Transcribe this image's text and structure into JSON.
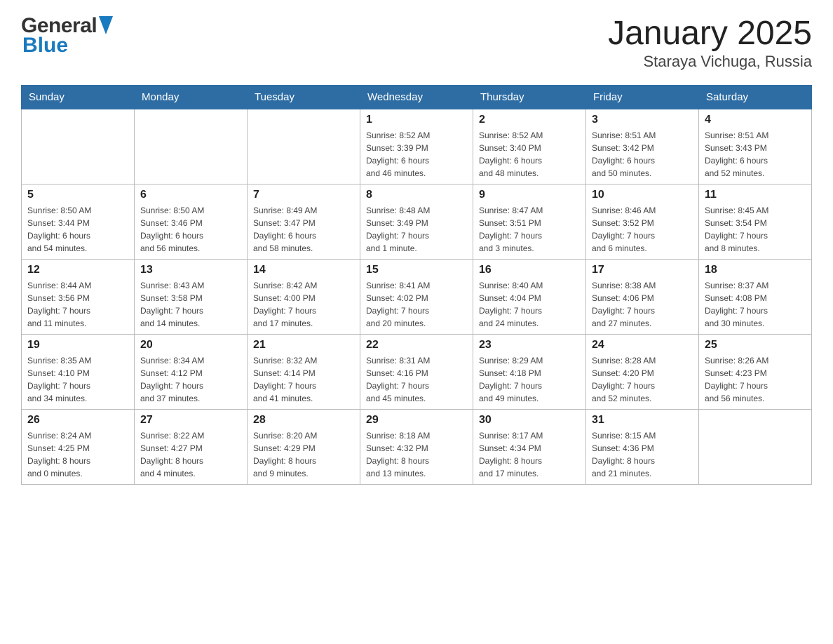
{
  "header": {
    "logo_general": "General",
    "logo_blue": "Blue",
    "title": "January 2025",
    "subtitle": "Staraya Vichuga, Russia"
  },
  "days_of_week": [
    "Sunday",
    "Monday",
    "Tuesday",
    "Wednesday",
    "Thursday",
    "Friday",
    "Saturday"
  ],
  "weeks": [
    [
      {
        "day": "",
        "info": ""
      },
      {
        "day": "",
        "info": ""
      },
      {
        "day": "",
        "info": ""
      },
      {
        "day": "1",
        "info": "Sunrise: 8:52 AM\nSunset: 3:39 PM\nDaylight: 6 hours\nand 46 minutes."
      },
      {
        "day": "2",
        "info": "Sunrise: 8:52 AM\nSunset: 3:40 PM\nDaylight: 6 hours\nand 48 minutes."
      },
      {
        "day": "3",
        "info": "Sunrise: 8:51 AM\nSunset: 3:42 PM\nDaylight: 6 hours\nand 50 minutes."
      },
      {
        "day": "4",
        "info": "Sunrise: 8:51 AM\nSunset: 3:43 PM\nDaylight: 6 hours\nand 52 minutes."
      }
    ],
    [
      {
        "day": "5",
        "info": "Sunrise: 8:50 AM\nSunset: 3:44 PM\nDaylight: 6 hours\nand 54 minutes."
      },
      {
        "day": "6",
        "info": "Sunrise: 8:50 AM\nSunset: 3:46 PM\nDaylight: 6 hours\nand 56 minutes."
      },
      {
        "day": "7",
        "info": "Sunrise: 8:49 AM\nSunset: 3:47 PM\nDaylight: 6 hours\nand 58 minutes."
      },
      {
        "day": "8",
        "info": "Sunrise: 8:48 AM\nSunset: 3:49 PM\nDaylight: 7 hours\nand 1 minute."
      },
      {
        "day": "9",
        "info": "Sunrise: 8:47 AM\nSunset: 3:51 PM\nDaylight: 7 hours\nand 3 minutes."
      },
      {
        "day": "10",
        "info": "Sunrise: 8:46 AM\nSunset: 3:52 PM\nDaylight: 7 hours\nand 6 minutes."
      },
      {
        "day": "11",
        "info": "Sunrise: 8:45 AM\nSunset: 3:54 PM\nDaylight: 7 hours\nand 8 minutes."
      }
    ],
    [
      {
        "day": "12",
        "info": "Sunrise: 8:44 AM\nSunset: 3:56 PM\nDaylight: 7 hours\nand 11 minutes."
      },
      {
        "day": "13",
        "info": "Sunrise: 8:43 AM\nSunset: 3:58 PM\nDaylight: 7 hours\nand 14 minutes."
      },
      {
        "day": "14",
        "info": "Sunrise: 8:42 AM\nSunset: 4:00 PM\nDaylight: 7 hours\nand 17 minutes."
      },
      {
        "day": "15",
        "info": "Sunrise: 8:41 AM\nSunset: 4:02 PM\nDaylight: 7 hours\nand 20 minutes."
      },
      {
        "day": "16",
        "info": "Sunrise: 8:40 AM\nSunset: 4:04 PM\nDaylight: 7 hours\nand 24 minutes."
      },
      {
        "day": "17",
        "info": "Sunrise: 8:38 AM\nSunset: 4:06 PM\nDaylight: 7 hours\nand 27 minutes."
      },
      {
        "day": "18",
        "info": "Sunrise: 8:37 AM\nSunset: 4:08 PM\nDaylight: 7 hours\nand 30 minutes."
      }
    ],
    [
      {
        "day": "19",
        "info": "Sunrise: 8:35 AM\nSunset: 4:10 PM\nDaylight: 7 hours\nand 34 minutes."
      },
      {
        "day": "20",
        "info": "Sunrise: 8:34 AM\nSunset: 4:12 PM\nDaylight: 7 hours\nand 37 minutes."
      },
      {
        "day": "21",
        "info": "Sunrise: 8:32 AM\nSunset: 4:14 PM\nDaylight: 7 hours\nand 41 minutes."
      },
      {
        "day": "22",
        "info": "Sunrise: 8:31 AM\nSunset: 4:16 PM\nDaylight: 7 hours\nand 45 minutes."
      },
      {
        "day": "23",
        "info": "Sunrise: 8:29 AM\nSunset: 4:18 PM\nDaylight: 7 hours\nand 49 minutes."
      },
      {
        "day": "24",
        "info": "Sunrise: 8:28 AM\nSunset: 4:20 PM\nDaylight: 7 hours\nand 52 minutes."
      },
      {
        "day": "25",
        "info": "Sunrise: 8:26 AM\nSunset: 4:23 PM\nDaylight: 7 hours\nand 56 minutes."
      }
    ],
    [
      {
        "day": "26",
        "info": "Sunrise: 8:24 AM\nSunset: 4:25 PM\nDaylight: 8 hours\nand 0 minutes."
      },
      {
        "day": "27",
        "info": "Sunrise: 8:22 AM\nSunset: 4:27 PM\nDaylight: 8 hours\nand 4 minutes."
      },
      {
        "day": "28",
        "info": "Sunrise: 8:20 AM\nSunset: 4:29 PM\nDaylight: 8 hours\nand 9 minutes."
      },
      {
        "day": "29",
        "info": "Sunrise: 8:18 AM\nSunset: 4:32 PM\nDaylight: 8 hours\nand 13 minutes."
      },
      {
        "day": "30",
        "info": "Sunrise: 8:17 AM\nSunset: 4:34 PM\nDaylight: 8 hours\nand 17 minutes."
      },
      {
        "day": "31",
        "info": "Sunrise: 8:15 AM\nSunset: 4:36 PM\nDaylight: 8 hours\nand 21 minutes."
      },
      {
        "day": "",
        "info": ""
      }
    ]
  ]
}
